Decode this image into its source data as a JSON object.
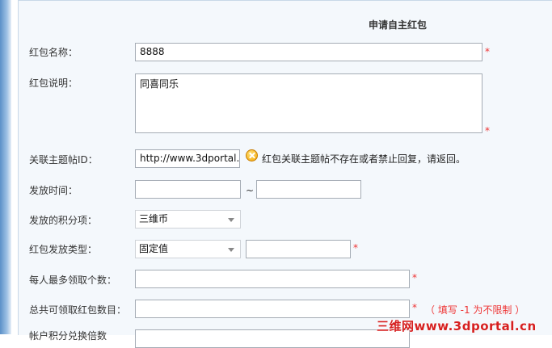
{
  "form": {
    "title": "申请自主红包",
    "fields": {
      "name": {
        "label": "红包名称：",
        "value": "8888"
      },
      "description": {
        "label": "红包说明：",
        "value": "同喜同乐"
      },
      "thread_id": {
        "label": "关联主题帖ID：",
        "value": "http://www.3dportal.",
        "error": "红包关联主题帖不存在或者禁止回复，请返回。"
      },
      "time": {
        "label": "发放时间：",
        "start": "",
        "end": "",
        "separator": "~"
      },
      "points": {
        "label": "发放的积分项：",
        "selected": "三维币"
      },
      "type": {
        "label": "红包发放类型：",
        "selected": "固定值",
        "value": ""
      },
      "per_person": {
        "label": "每人最多领取个数：",
        "value": ""
      },
      "total": {
        "label": "总共可领取红包数目：",
        "value": "",
        "hint": "（ 填写 -1 为不限制 ）"
      },
      "partial": {
        "label": "帐户积分兑换倍数"
      }
    },
    "required_mark": "*"
  },
  "watermark": "三维网www.3dportal.cn",
  "colors": {
    "required": "#e33333",
    "panel": "#f4f8fc",
    "accent": "#5b90c8"
  },
  "icons": {
    "error": "error-icon"
  }
}
